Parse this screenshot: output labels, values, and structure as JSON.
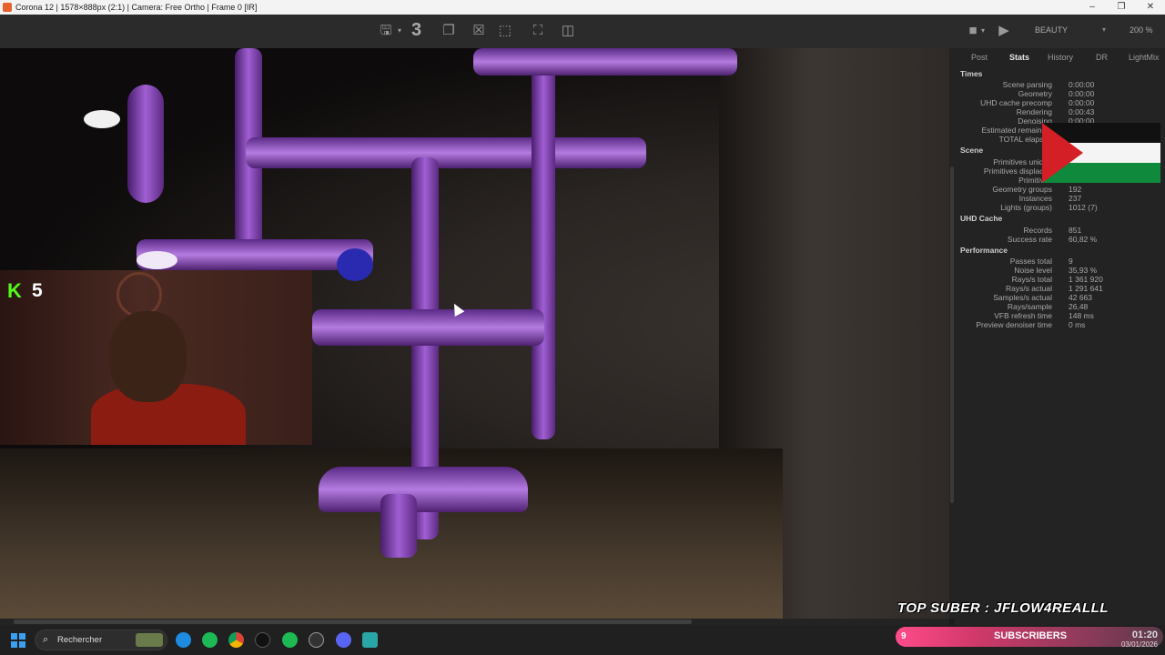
{
  "window": {
    "title": "Corona 12 | 1578×888px (2:1) | Camera: Free Ortho | Frame 0 [IR]",
    "controls": [
      "–",
      "❐",
      "✕"
    ]
  },
  "toolbar": {
    "passes_number": "3",
    "icons": [
      "save-icon",
      "copy-icon",
      "clear-icon",
      "region-icon",
      "fit-icon",
      "split-icon"
    ],
    "render_mode": "BEAUTY",
    "dr_label": "DR",
    "zoom": "200 %"
  },
  "tabs": [
    "Post",
    "Stats",
    "History",
    "DR",
    "LightMix"
  ],
  "active_tab": "Stats",
  "stats": {
    "times_title": "Times",
    "times": [
      {
        "label": "Scene parsing",
        "value": "0:00:00"
      },
      {
        "label": "Geometry",
        "value": "0:00:00"
      },
      {
        "label": "UHD cache precomp",
        "value": "0:00:00"
      },
      {
        "label": "Rendering",
        "value": "0:00:43"
      },
      {
        "label": "Denoising",
        "value": "0:00:00"
      },
      {
        "label": "Estimated remaining",
        "value": ""
      },
      {
        "label": "TOTAL elapsed",
        "value": ""
      }
    ],
    "scene_title": "Scene",
    "scene": [
      {
        "label": "Primitives unique",
        "value": ""
      },
      {
        "label": "Primitives displaced",
        "value": ""
      },
      {
        "label": "Primitives",
        "value": ""
      },
      {
        "label": "Geometry groups",
        "value": "192"
      },
      {
        "label": "Instances",
        "value": "237"
      },
      {
        "label": "Lights (groups)",
        "value": "1012 (7)"
      }
    ],
    "uhd_title": "UHD Cache",
    "uhd": [
      {
        "label": "Records",
        "value": "851"
      },
      {
        "label": "Success rate",
        "value": "60,82 %"
      }
    ],
    "perf_title": "Performance",
    "perf": [
      {
        "label": "Passes total",
        "value": "9"
      },
      {
        "label": "Noise level",
        "value": "35,93 %"
      },
      {
        "label": "Rays/s total",
        "value": "1 361 920"
      },
      {
        "label": "Rays/s actual",
        "value": "1 291 641"
      },
      {
        "label": "Samples/s actual",
        "value": "42 663"
      },
      {
        "label": "Rays/sample",
        "value": "26,48"
      },
      {
        "label": "VFB refresh time",
        "value": "148 ms"
      },
      {
        "label": "Preview denoiser time",
        "value": "0 ms"
      }
    ]
  },
  "overlay": {
    "kick_count": "5",
    "top_suber": "TOP SUBER : JFLOW4REALLL",
    "subscribers_count": "9",
    "subscribers_label": "SUBSCRIBERS"
  },
  "taskbar": {
    "search_placeholder": "Rechercher",
    "apps": [
      "edge-icon",
      "spotify-icon",
      "chrome-icon",
      "tiktok-icon",
      "spotify2-icon",
      "obs-icon",
      "discord-icon",
      "corona-icon"
    ],
    "time": "01:20",
    "date": "03/01/2026"
  },
  "colors": {
    "pipe": "#a05fd3",
    "kick_green": "#53fc18",
    "subs_pink": "#ff4b8a"
  }
}
